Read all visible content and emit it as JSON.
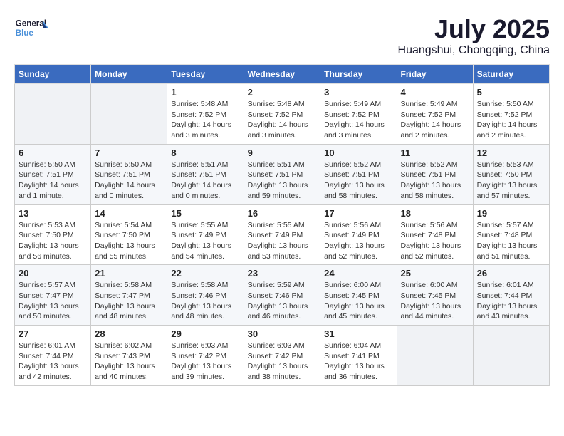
{
  "header": {
    "logo_general": "General",
    "logo_blue": "Blue",
    "month_year": "July 2025",
    "location": "Huangshui, Chongqing, China"
  },
  "weekdays": [
    "Sunday",
    "Monday",
    "Tuesday",
    "Wednesday",
    "Thursday",
    "Friday",
    "Saturday"
  ],
  "weeks": [
    [
      {
        "day": "",
        "info": ""
      },
      {
        "day": "",
        "info": ""
      },
      {
        "day": "1",
        "info": "Sunrise: 5:48 AM\nSunset: 7:52 PM\nDaylight: 14 hours\nand 3 minutes."
      },
      {
        "day": "2",
        "info": "Sunrise: 5:48 AM\nSunset: 7:52 PM\nDaylight: 14 hours\nand 3 minutes."
      },
      {
        "day": "3",
        "info": "Sunrise: 5:49 AM\nSunset: 7:52 PM\nDaylight: 14 hours\nand 3 minutes."
      },
      {
        "day": "4",
        "info": "Sunrise: 5:49 AM\nSunset: 7:52 PM\nDaylight: 14 hours\nand 2 minutes."
      },
      {
        "day": "5",
        "info": "Sunrise: 5:50 AM\nSunset: 7:52 PM\nDaylight: 14 hours\nand 2 minutes."
      }
    ],
    [
      {
        "day": "6",
        "info": "Sunrise: 5:50 AM\nSunset: 7:51 PM\nDaylight: 14 hours\nand 1 minute."
      },
      {
        "day": "7",
        "info": "Sunrise: 5:50 AM\nSunset: 7:51 PM\nDaylight: 14 hours\nand 0 minutes."
      },
      {
        "day": "8",
        "info": "Sunrise: 5:51 AM\nSunset: 7:51 PM\nDaylight: 14 hours\nand 0 minutes."
      },
      {
        "day": "9",
        "info": "Sunrise: 5:51 AM\nSunset: 7:51 PM\nDaylight: 13 hours\nand 59 minutes."
      },
      {
        "day": "10",
        "info": "Sunrise: 5:52 AM\nSunset: 7:51 PM\nDaylight: 13 hours\nand 58 minutes."
      },
      {
        "day": "11",
        "info": "Sunrise: 5:52 AM\nSunset: 7:51 PM\nDaylight: 13 hours\nand 58 minutes."
      },
      {
        "day": "12",
        "info": "Sunrise: 5:53 AM\nSunset: 7:50 PM\nDaylight: 13 hours\nand 57 minutes."
      }
    ],
    [
      {
        "day": "13",
        "info": "Sunrise: 5:53 AM\nSunset: 7:50 PM\nDaylight: 13 hours\nand 56 minutes."
      },
      {
        "day": "14",
        "info": "Sunrise: 5:54 AM\nSunset: 7:50 PM\nDaylight: 13 hours\nand 55 minutes."
      },
      {
        "day": "15",
        "info": "Sunrise: 5:55 AM\nSunset: 7:49 PM\nDaylight: 13 hours\nand 54 minutes."
      },
      {
        "day": "16",
        "info": "Sunrise: 5:55 AM\nSunset: 7:49 PM\nDaylight: 13 hours\nand 53 minutes."
      },
      {
        "day": "17",
        "info": "Sunrise: 5:56 AM\nSunset: 7:49 PM\nDaylight: 13 hours\nand 52 minutes."
      },
      {
        "day": "18",
        "info": "Sunrise: 5:56 AM\nSunset: 7:48 PM\nDaylight: 13 hours\nand 52 minutes."
      },
      {
        "day": "19",
        "info": "Sunrise: 5:57 AM\nSunset: 7:48 PM\nDaylight: 13 hours\nand 51 minutes."
      }
    ],
    [
      {
        "day": "20",
        "info": "Sunrise: 5:57 AM\nSunset: 7:47 PM\nDaylight: 13 hours\nand 50 minutes."
      },
      {
        "day": "21",
        "info": "Sunrise: 5:58 AM\nSunset: 7:47 PM\nDaylight: 13 hours\nand 48 minutes."
      },
      {
        "day": "22",
        "info": "Sunrise: 5:58 AM\nSunset: 7:46 PM\nDaylight: 13 hours\nand 48 minutes."
      },
      {
        "day": "23",
        "info": "Sunrise: 5:59 AM\nSunset: 7:46 PM\nDaylight: 13 hours\nand 46 minutes."
      },
      {
        "day": "24",
        "info": "Sunrise: 6:00 AM\nSunset: 7:45 PM\nDaylight: 13 hours\nand 45 minutes."
      },
      {
        "day": "25",
        "info": "Sunrise: 6:00 AM\nSunset: 7:45 PM\nDaylight: 13 hours\nand 44 minutes."
      },
      {
        "day": "26",
        "info": "Sunrise: 6:01 AM\nSunset: 7:44 PM\nDaylight: 13 hours\nand 43 minutes."
      }
    ],
    [
      {
        "day": "27",
        "info": "Sunrise: 6:01 AM\nSunset: 7:44 PM\nDaylight: 13 hours\nand 42 minutes."
      },
      {
        "day": "28",
        "info": "Sunrise: 6:02 AM\nSunset: 7:43 PM\nDaylight: 13 hours\nand 40 minutes."
      },
      {
        "day": "29",
        "info": "Sunrise: 6:03 AM\nSunset: 7:42 PM\nDaylight: 13 hours\nand 39 minutes."
      },
      {
        "day": "30",
        "info": "Sunrise: 6:03 AM\nSunset: 7:42 PM\nDaylight: 13 hours\nand 38 minutes."
      },
      {
        "day": "31",
        "info": "Sunrise: 6:04 AM\nSunset: 7:41 PM\nDaylight: 13 hours\nand 36 minutes."
      },
      {
        "day": "",
        "info": ""
      },
      {
        "day": "",
        "info": ""
      }
    ]
  ]
}
